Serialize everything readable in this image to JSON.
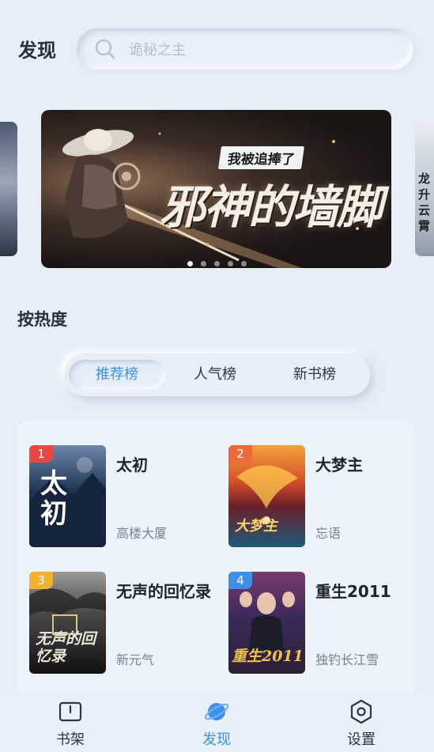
{
  "header": {
    "title": "发现"
  },
  "search": {
    "placeholder": "诡秘之主",
    "icon": "search-icon"
  },
  "banner": {
    "subtitle": "我被追捧了",
    "title": "邪神的墙脚",
    "right_card_text": "龙升云霄",
    "dots_total": 5,
    "dots_active_index": 0
  },
  "section": {
    "title": "按热度"
  },
  "tabs": [
    {
      "label": "推荐榜",
      "active": true
    },
    {
      "label": "人气榜",
      "active": false
    },
    {
      "label": "新书榜",
      "active": false
    }
  ],
  "books": [
    {
      "rank": "1",
      "name": "太初",
      "author": "高楼大厦",
      "cover_text": "太初",
      "rank_color": "#e8483f"
    },
    {
      "rank": "2",
      "name": "大梦主",
      "author": "忘语",
      "cover_text": "大梦主",
      "rank_color": "#ef6a3a"
    },
    {
      "rank": "3",
      "name": "无声的回忆录",
      "author": "新元气",
      "cover_text": "无声的回忆录",
      "rank_color": "#f2b12e"
    },
    {
      "rank": "4",
      "name": "重生2011",
      "author": "独钓长江雪",
      "cover_text": "重生2011",
      "rank_color": "#3f8ee8"
    }
  ],
  "bottom_nav": [
    {
      "label": "书架",
      "icon": "book-icon",
      "active": false
    },
    {
      "label": "发现",
      "icon": "planet-icon",
      "active": true
    },
    {
      "label": "设置",
      "icon": "hexagon-settings-icon",
      "active": false
    }
  ],
  "colors": {
    "accent": "#3f8ee8",
    "background": "#e6eef8"
  }
}
